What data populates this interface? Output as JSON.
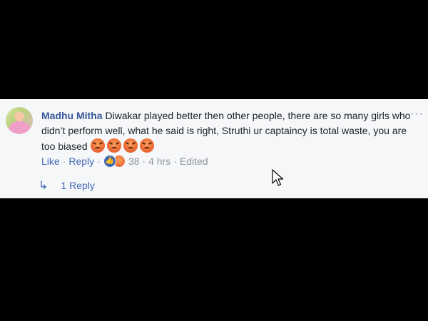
{
  "comment": {
    "author": "Madhu Mitha",
    "text": "Diwakar played better then other people, there are so many girls who didn’t perform well, what he said is right, Struthi ur captaincy is total waste, you are too biased",
    "more_label": "···"
  },
  "actions": {
    "like_label": "Like",
    "reply_label": "Reply",
    "reaction_count": "38",
    "time": "4 hrs",
    "edited": "Edited",
    "separator": "·"
  },
  "replies": {
    "label": "1 Reply"
  },
  "icons": [
    "avatar",
    "angry-emoji",
    "like-reaction-icon",
    "angry-reaction-icon",
    "reply-arrow-icon",
    "more-options-icon",
    "mouse-cursor-icon"
  ],
  "colors": {
    "author": "#365899",
    "link": "#4267b2",
    "meta": "#90949c",
    "panel": "#f6f7f9"
  }
}
